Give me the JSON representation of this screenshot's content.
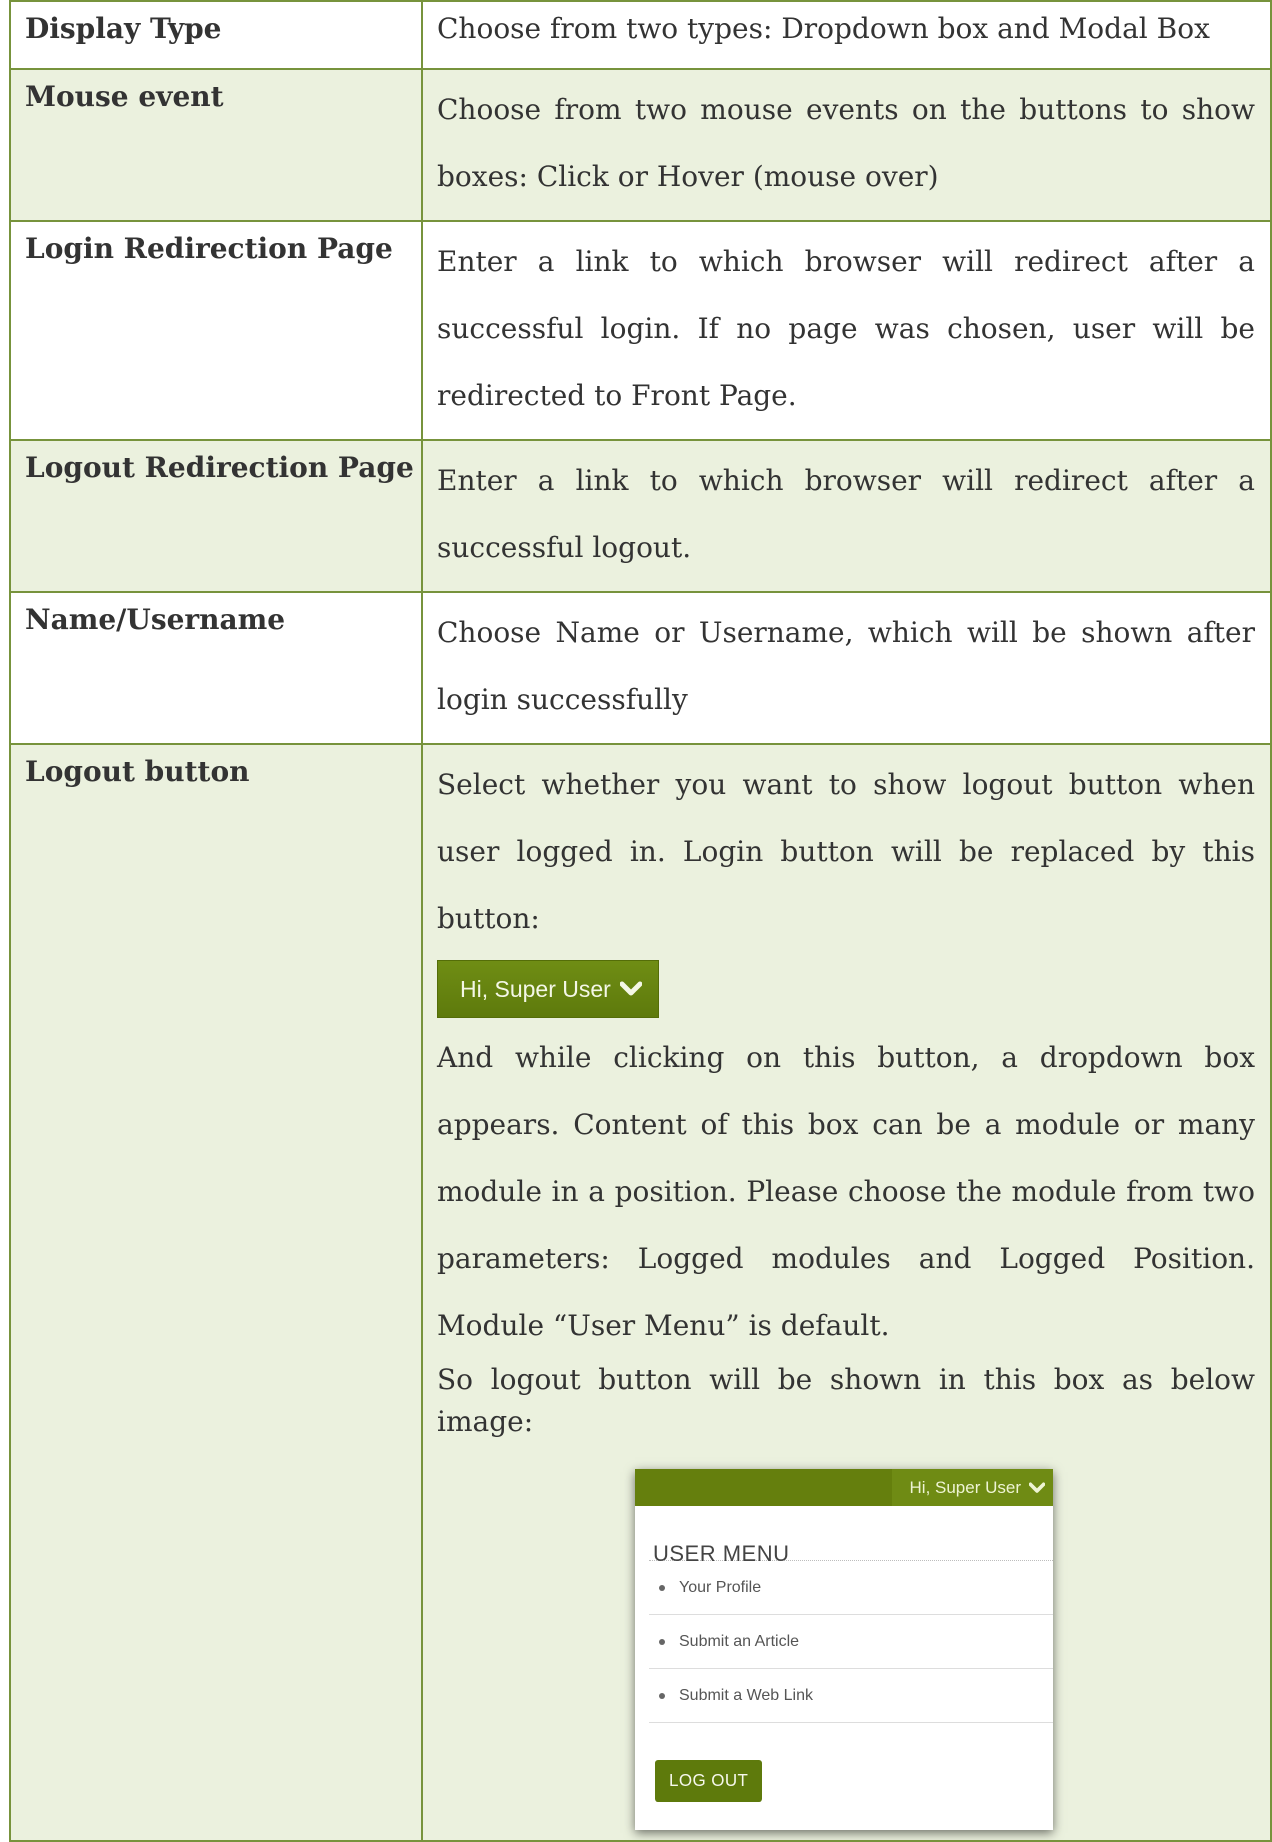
{
  "rows": [
    {
      "key": "Display Type",
      "value": "Choose from two types: Dropdown box and Modal Box"
    },
    {
      "key": "Mouse event",
      "value": "Choose from two mouse events on the buttons to show boxes: Click or Hover (mouse over)"
    },
    {
      "key": "Login Redirection Page",
      "value": "Enter a link to which browser will redirect after a successful login. If no page was chosen, user will be redirected to Front Page."
    },
    {
      "key": "Logout Redirection Page",
      "value": "Enter a link to which browser will redirect after a successful logout."
    },
    {
      "key": "Name/Username",
      "value": "Choose Name or Username, which will be shown after login successfully"
    },
    {
      "key": "Logout button",
      "intro": "Select whether you want to show logout button when user logged in. Login button will be replaced by this button:",
      "button_label": "Hi, Super User",
      "para2": "And while clicking on this button, a dropdown box appears. Content of this box can be a module or many module in a position. Please choose the module from two parameters: Logged modules and Logged Position. Module “User Menu” is default.",
      "para3": "So logout button will be shown in this box as below image:"
    }
  ],
  "menu_mock": {
    "header_button": "Hi, Super User",
    "title": "USER MENU",
    "items": [
      "Your Profile",
      "Submit an Article",
      "Submit a Web Link"
    ],
    "logout_label": "LOG OUT"
  },
  "colors": {
    "border": "#77933c",
    "shade": "#ebf1de",
    "button_green": "#5e7a0c"
  }
}
